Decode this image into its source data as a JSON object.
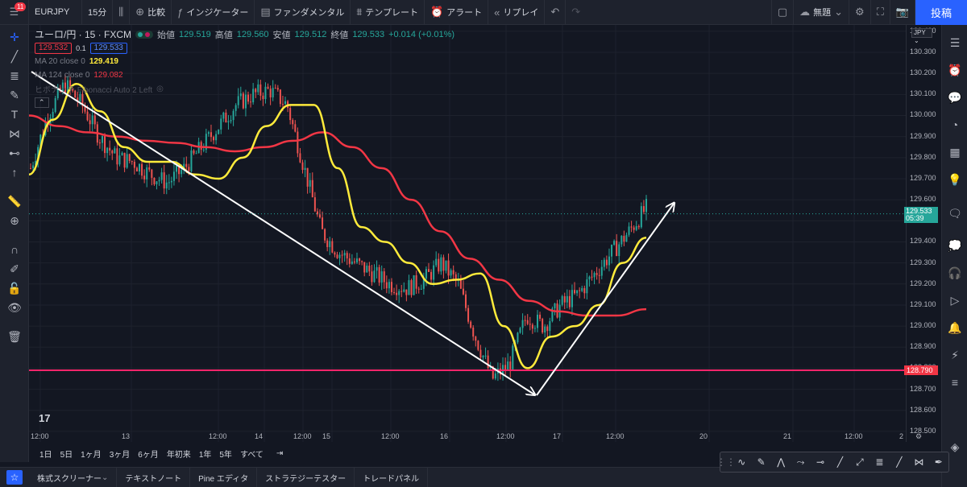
{
  "toolbar": {
    "notifications": "11",
    "symbol": "EURJPY",
    "interval": "15分",
    "compare": "比較",
    "indicators": "インジケーター",
    "fundamentals": "ファンダメンタル",
    "templates": "テンプレート",
    "alert": "アラート",
    "replay": "リプレイ",
    "layout_name": "無題",
    "post": "投稿"
  },
  "legend": {
    "symbol_title": "ユーロ/円 · 15 · FXCM",
    "open_label": "始値",
    "open": "129.519",
    "high_label": "高値",
    "high": "129.560",
    "low_label": "安値",
    "low": "129.512",
    "close_label": "終値",
    "close": "129.533",
    "change": "+0.014 (+0.01%)",
    "bid": "129.532",
    "spread": "0.1",
    "ask": "129.533",
    "ma20_label": "MA 20 close 0",
    "ma20_value": "129.419",
    "ma124_label": "MA 124 close 0",
    "ma124_value": "129.082",
    "fib_label": "ヒボナッチ Fibonacci Auto 2 Left"
  },
  "price_axis": {
    "currency": "JPY",
    "ticks": [
      "130.400",
      "130.300",
      "130.200",
      "130.100",
      "130.000",
      "129.900",
      "129.800",
      "129.700",
      "129.600",
      "129.500",
      "129.400",
      "129.300",
      "129.200",
      "129.100",
      "129.000",
      "128.900",
      "128.800",
      "128.700",
      "128.600",
      "128.500"
    ],
    "current_price": "129.533",
    "countdown": "05:39",
    "level_price": "128.790"
  },
  "time_axis": [
    "12:00",
    "13",
    "12:00",
    "14",
    "12:00",
    "15",
    "12:00",
    "16",
    "12:00",
    "17",
    "12:00",
    "20",
    "21",
    "12:00",
    "2"
  ],
  "ranges": [
    "1日",
    "5日",
    "1ヶ月",
    "3ヶ月",
    "6ヶ月",
    "年初来",
    "1年",
    "5年",
    "すべて"
  ],
  "bottom_tabs": [
    "株式スクリーナー",
    "テキストノート",
    "Pine エディタ",
    "ストラテジーテスター",
    "トレードパネル"
  ],
  "colors": {
    "background": "#131722",
    "ma20": "#ffeb3b",
    "ma124": "#f23645",
    "level_line": "#f7256a",
    "up": "#26a69a",
    "down": "#ef5350"
  },
  "chart_data": {
    "type": "line",
    "symbol": "EURJPY",
    "ylim": [
      128.45,
      130.43
    ],
    "price_series": [
      129.75,
      130.0,
      130.15,
      130.05,
      129.9,
      129.8,
      129.78,
      129.72,
      129.68,
      129.75,
      129.85,
      129.95,
      130.05,
      130.1,
      130.12,
      130.05,
      129.75,
      129.45,
      129.35,
      129.3,
      129.25,
      129.2,
      129.18,
      129.22,
      129.3,
      129.2,
      128.95,
      128.75,
      128.82,
      129.05,
      129.0,
      129.1,
      129.15,
      129.25,
      129.35,
      129.45,
      129.56
    ],
    "series": [
      {
        "name": "MA 20 close 0",
        "values": [
          129.72,
          129.98,
          130.15,
          130.02,
          129.85,
          129.78,
          129.78,
          129.72,
          129.7,
          129.8,
          129.95,
          130.05,
          130.05,
          129.75,
          129.47,
          129.4,
          129.3,
          129.2,
          129.22,
          129.25,
          129.0,
          128.8,
          128.95,
          129.0,
          129.1,
          129.3,
          129.42
        ]
      },
      {
        "name": "MA 124 close 0",
        "values": [
          130.0,
          129.95,
          129.92,
          129.9,
          129.88,
          129.87,
          129.85,
          129.83,
          129.85,
          129.88,
          129.92,
          129.85,
          129.75,
          129.6,
          129.45,
          129.32,
          129.22,
          129.12,
          129.07,
          129.05,
          129.05,
          129.08
        ]
      }
    ],
    "horizontal_level": 128.79
  }
}
